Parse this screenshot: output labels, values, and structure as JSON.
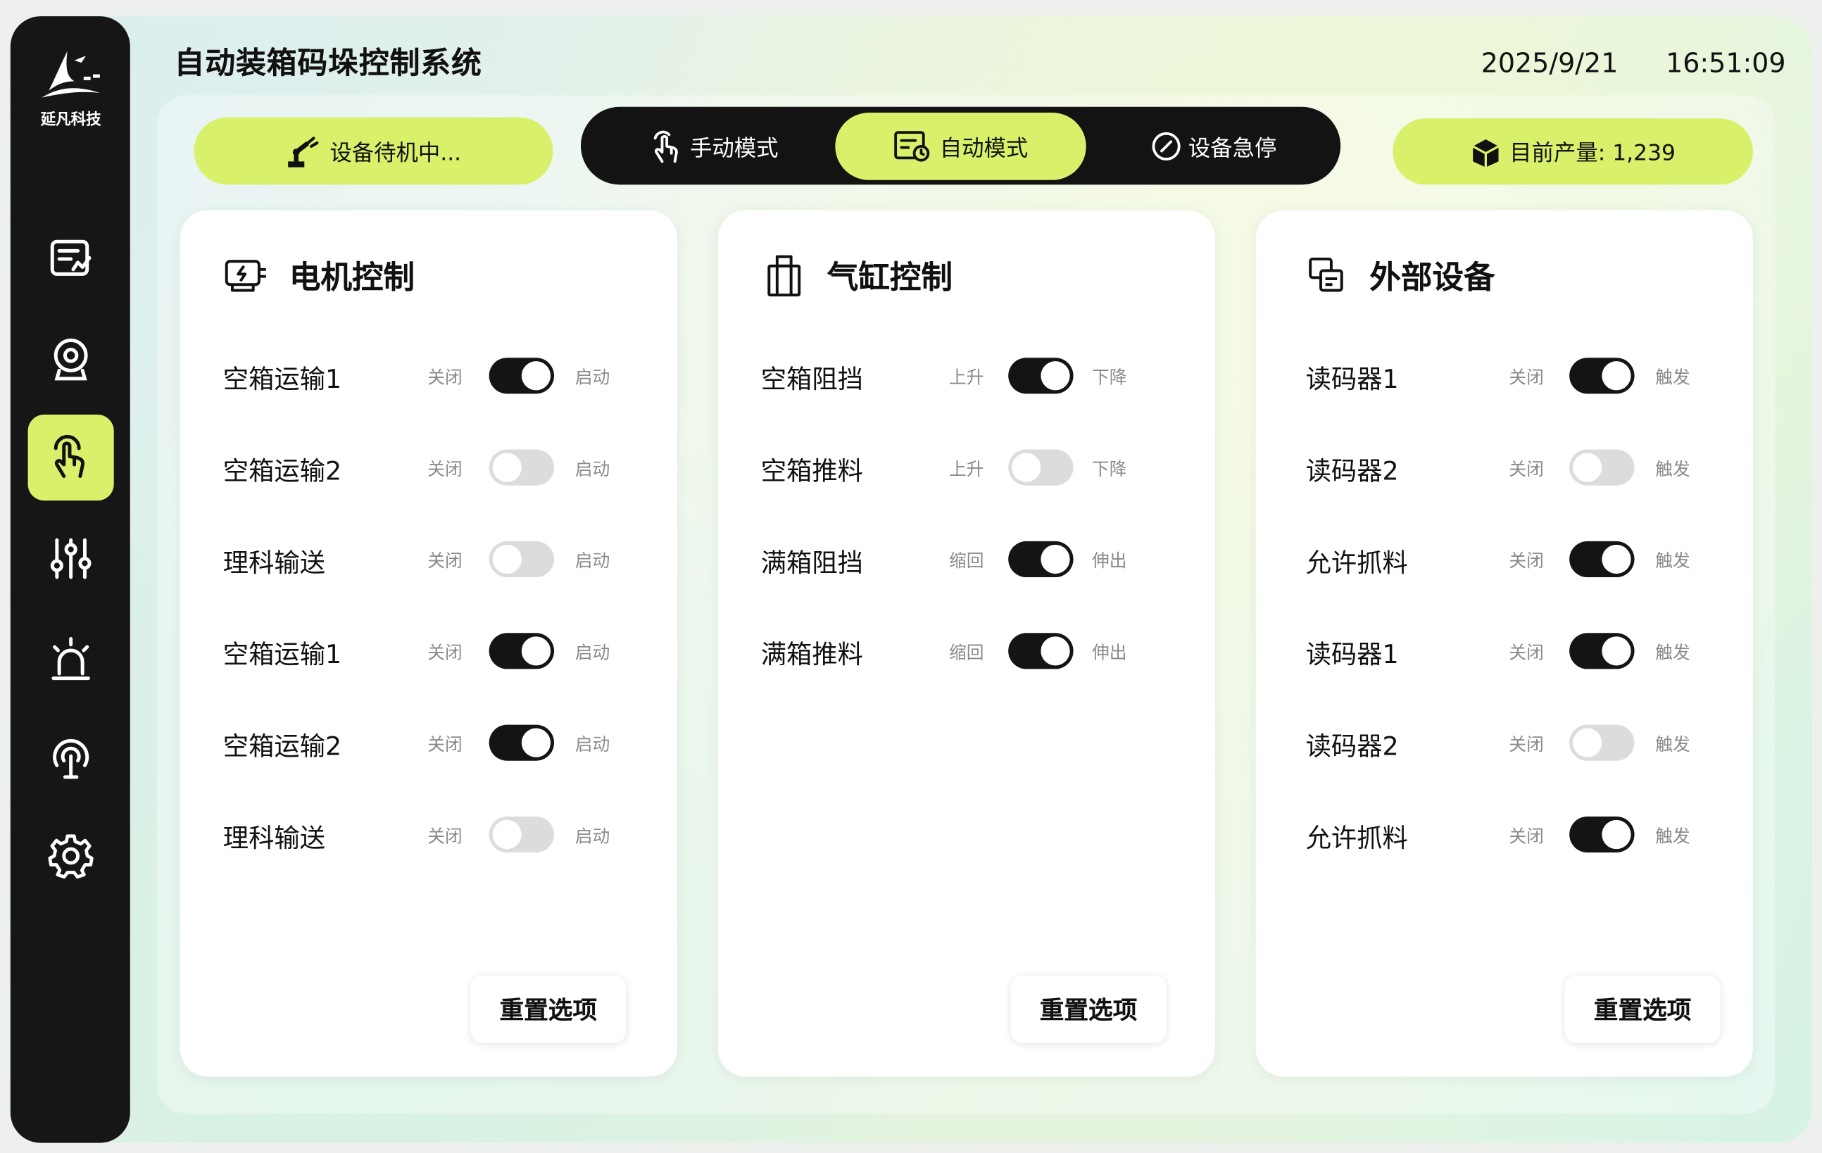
{
  "app": {
    "title": "自动装箱码垛控制系统",
    "date": "2025/9/21",
    "time": "16:51:09",
    "logo_text": "延凡科技"
  },
  "nav": [
    {
      "icon": "report-icon"
    },
    {
      "icon": "camera-icon"
    },
    {
      "icon": "hand-touch-icon",
      "active": true
    },
    {
      "icon": "sliders-icon"
    },
    {
      "icon": "alarm-icon"
    },
    {
      "icon": "broadcast-icon"
    },
    {
      "icon": "gear-icon"
    }
  ],
  "header": {
    "status": "设备待机中...",
    "modes": {
      "manual": "手动模式",
      "auto": "自动模式",
      "estop": "设备急停"
    },
    "active_mode": "auto",
    "production": "目前产量: 1,239"
  },
  "cards": {
    "motor": {
      "title": "电机控制",
      "rows": [
        {
          "label": "空箱运输1",
          "off": "关闭",
          "on": "启动",
          "state": true
        },
        {
          "label": "空箱运输2",
          "off": "关闭",
          "on": "启动",
          "state": false
        },
        {
          "label": "理科输送",
          "off": "关闭",
          "on": "启动",
          "state": false
        },
        {
          "label": "空箱运输1",
          "off": "关闭",
          "on": "启动",
          "state": true
        },
        {
          "label": "空箱运输2",
          "off": "关闭",
          "on": "启动",
          "state": true
        },
        {
          "label": "理科输送",
          "off": "关闭",
          "on": "启动",
          "state": false
        }
      ],
      "reset": "重置选项"
    },
    "cylinder": {
      "title": "气缸控制",
      "rows": [
        {
          "label": "空箱阻挡",
          "off": "上升",
          "on": "下降",
          "state": true
        },
        {
          "label": "空箱推料",
          "off": "上升",
          "on": "下降",
          "state": false
        },
        {
          "label": "满箱阻挡",
          "off": "缩回",
          "on": "伸出",
          "state": true
        },
        {
          "label": "满箱推料",
          "off": "缩回",
          "on": "伸出",
          "state": true
        }
      ],
      "reset": "重置选项"
    },
    "external": {
      "title": "外部设备",
      "rows": [
        {
          "label": "读码器1",
          "off": "关闭",
          "on": "触发",
          "state": true
        },
        {
          "label": "读码器2",
          "off": "关闭",
          "on": "触发",
          "state": false
        },
        {
          "label": "允许抓料",
          "off": "关闭",
          "on": "触发",
          "state": true
        },
        {
          "label": "读码器1",
          "off": "关闭",
          "on": "触发",
          "state": true
        },
        {
          "label": "读码器2",
          "off": "关闭",
          "on": "触发",
          "state": false
        },
        {
          "label": "允许抓料",
          "off": "关闭",
          "on": "触发",
          "state": true
        }
      ],
      "reset": "重置选项"
    }
  }
}
